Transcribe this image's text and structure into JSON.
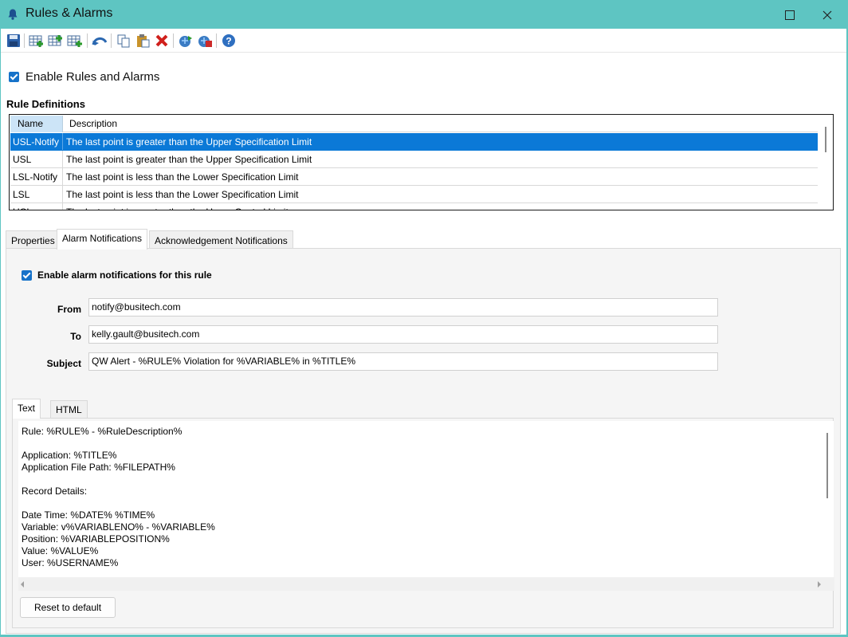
{
  "window": {
    "title": "Rules & Alarms",
    "title_icon": "bell-icon"
  },
  "toolbar": {
    "buttons": [
      {
        "name": "save-icon"
      },
      {
        "name": "add-rule-icon"
      },
      {
        "name": "insert-rule-icon"
      },
      {
        "name": "append-rule-icon"
      },
      {
        "name": "undo-icon"
      },
      {
        "name": "copy-icon"
      },
      {
        "name": "paste-icon"
      },
      {
        "name": "delete-icon"
      },
      {
        "name": "import-icon"
      },
      {
        "name": "export-icon"
      },
      {
        "name": "help-icon"
      }
    ]
  },
  "enable_rules": {
    "label": "Enable Rules and Alarms",
    "checked": true
  },
  "rule_definitions": {
    "label": "Rule Definitions",
    "columns": [
      "Name",
      "Description"
    ],
    "rows": [
      {
        "name": "USL-Notify",
        "description": "The last point is greater than the Upper Specification Limit",
        "selected": true
      },
      {
        "name": "USL",
        "description": "The last point is greater than the Upper Specification Limit",
        "selected": false
      },
      {
        "name": "LSL-Notify",
        "description": "The last point is less than the Lower Specification Limit",
        "selected": false
      },
      {
        "name": "LSL",
        "description": "The last point is less than the Lower Specification Limit",
        "selected": false
      },
      {
        "name": "UCL",
        "description": "The last point is greater than the Upper Control Limit",
        "selected": false
      }
    ]
  },
  "tabs": [
    "Properties",
    "Alarm Notifications",
    "Acknowledgement Notifications"
  ],
  "active_tab": "Alarm Notifications",
  "alarm": {
    "enable_label": "Enable alarm notifications for this rule",
    "from_label": "From",
    "from_value": "notify@busitech.com",
    "to_label": "To",
    "to_value": "kelly.gault@busitech.com",
    "subject_label": "Subject",
    "subject_value": "QW Alert - %RULE% Violation for %VARIABLE% in  %TITLE%",
    "body_tabs": [
      "Text",
      "HTML"
    ],
    "body_text": "Rule: %RULE% - %RuleDescription%\n\nApplication: %TITLE%\nApplication File Path: %FILEPATH%\n\nRecord Details:\n\nDate Time: %DATE% %TIME%\nVariable: v%VARIABLENO% - %VARIABLE%\nPosition: %VARIABLEPOSITION%\nValue: %VALUE%\nUser: %USERNAME%",
    "reset_label": "Reset to default"
  },
  "colors": {
    "titlebar": "#5ec5c2",
    "selection": "#0b79d7",
    "checkbox": "#1672c9"
  }
}
